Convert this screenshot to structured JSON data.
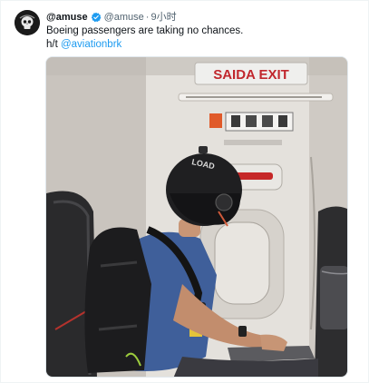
{
  "tweet": {
    "display_name": "@amuse",
    "handle": "@amuse",
    "separator": "·",
    "time": "9小时",
    "text_line1": "Boeing passengers are taking no chances.",
    "text_line2_prefix": "h/t ",
    "mention": "@aviationbrk"
  },
  "media": {
    "exit_sign_text": "SAIDA  EXIT",
    "helmet_text": "LOAD"
  },
  "icons": {
    "verified": "verified-badge-icon",
    "avatar": "avatar-skull-logo"
  },
  "colors": {
    "link": "#1d9bf0",
    "text": "#0f1419",
    "secondary": "#536471",
    "exit_red": "#c1272d"
  }
}
